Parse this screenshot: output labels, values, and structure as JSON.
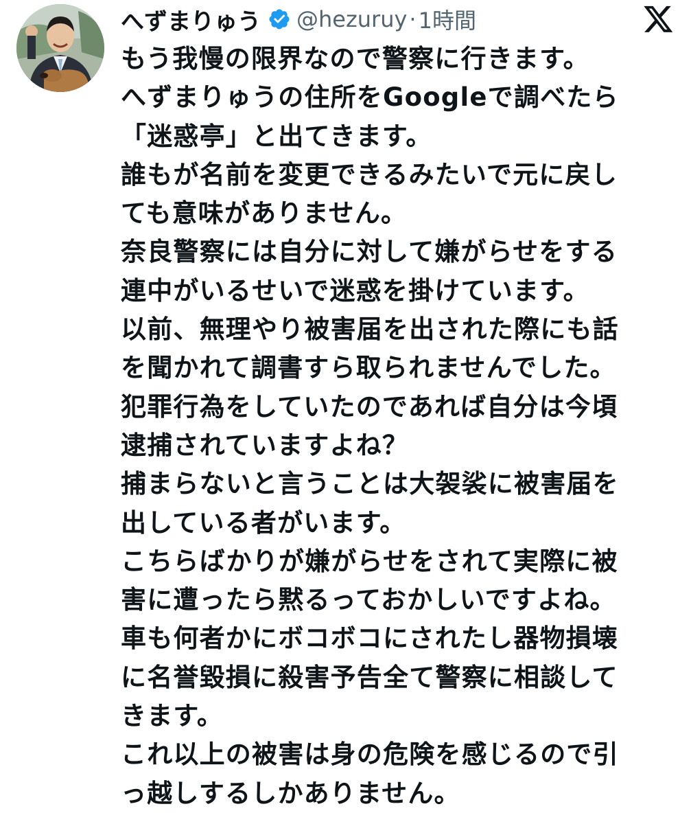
{
  "post": {
    "display_name": "へずまりゅう",
    "handle": "@hezuruy",
    "separator": "·",
    "time": "1時間",
    "verified_icon": "verified-badge-icon",
    "verified_color": "#1d9bf0",
    "platform_icon": "x-logo-icon",
    "avatar_icon": "avatar-photo",
    "lines": [
      "もう我慢の限界なので警察に行きます。",
      "へずまりゅうの住所をGoogleで調べたら",
      "「迷惑亭」と出てきます。",
      "誰もが名前を変更できるみたいで元に戻し",
      "ても意味がありません。",
      "奈良警察には自分に対して嫌がらせをする",
      "連中がいるせいで迷惑を掛けています。",
      "以前、無理やり被害届を出された際にも話",
      "を聞かれて調書すら取られませんでした。",
      "犯罪行為をしていたのであれば自分は今頃",
      "逮捕されていますよね？",
      "捕まらないと言うことは大袈裟に被害届を",
      "出している者がいます。",
      "こちらばかりが嫌がらせをされて実際に被",
      "害に遭ったら黙るっておかしいですよね。",
      "車も何者かにボコボコにされたし器物損壊",
      "に名誉毀損に殺害予告全て警察に相談して",
      "きます。",
      "これ以上の被害は身の危険を感じるので引",
      "っ越しするしかありません。"
    ]
  }
}
